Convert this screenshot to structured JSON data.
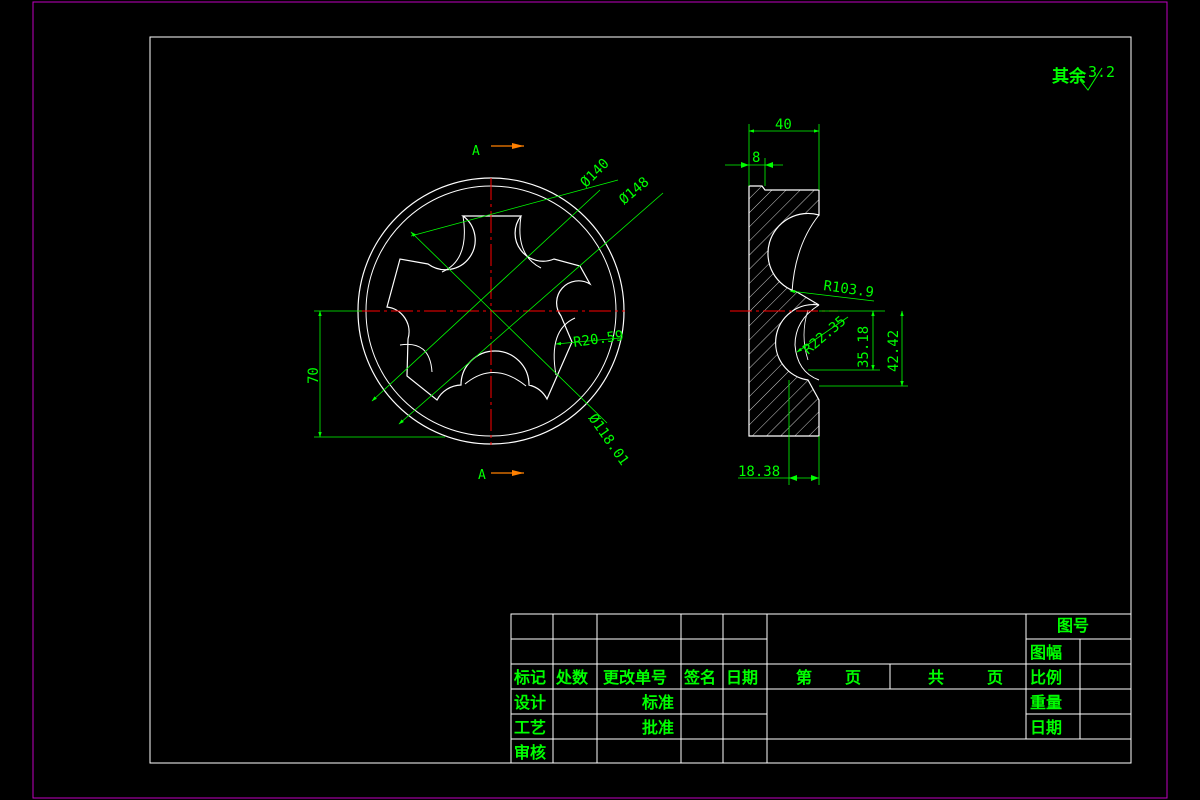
{
  "roughness": {
    "prefix": "其余",
    "value": "3.2"
  },
  "front_view": {
    "section_label_top": "A",
    "section_label_bottom": "A",
    "dims": {
      "d140": "Ø140",
      "d148": "Ø148",
      "r20": "R20.59",
      "d118": "Ø118.01",
      "h70": "70"
    }
  },
  "side_view": {
    "dims": {
      "w40": "40",
      "w8": "8",
      "r103": "R103.9",
      "r22": "R22.35",
      "d35": "35.18",
      "d42": "42.42",
      "w18": "18.38"
    }
  },
  "title_block": {
    "drawing_no": "图号",
    "sheet_size": "图幅",
    "scale": "比例",
    "weight": "重量",
    "date": "日期",
    "hdr_mark": "标记",
    "hdr_count": "处数",
    "hdr_change": "更改单号",
    "hdr_sign": "签名",
    "hdr_date": "日期",
    "sheet_no_a": "第",
    "sheet_no_b": "页",
    "sheet_total_a": "共",
    "sheet_total_b": "页",
    "design": "设计",
    "standard": "标准",
    "process": "工艺",
    "approve": "批准",
    "review": "审核"
  },
  "colors": {
    "border": "#c000c0",
    "outline": "#ffffff",
    "dimension": "#00ff00",
    "center": "#ff0000",
    "arrow": "#ff8000"
  }
}
